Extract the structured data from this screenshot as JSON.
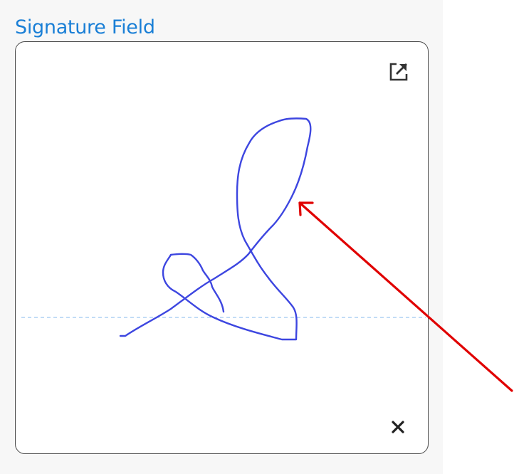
{
  "field": {
    "label": "Signature Field"
  },
  "icons": {
    "expand": "external-link-icon",
    "clear": "close-icon"
  },
  "colors": {
    "label": "#1a7fd6",
    "stroke": "#3d46e0",
    "baseline": "#9ec8f0",
    "annotation_arrow": "#e00000"
  }
}
